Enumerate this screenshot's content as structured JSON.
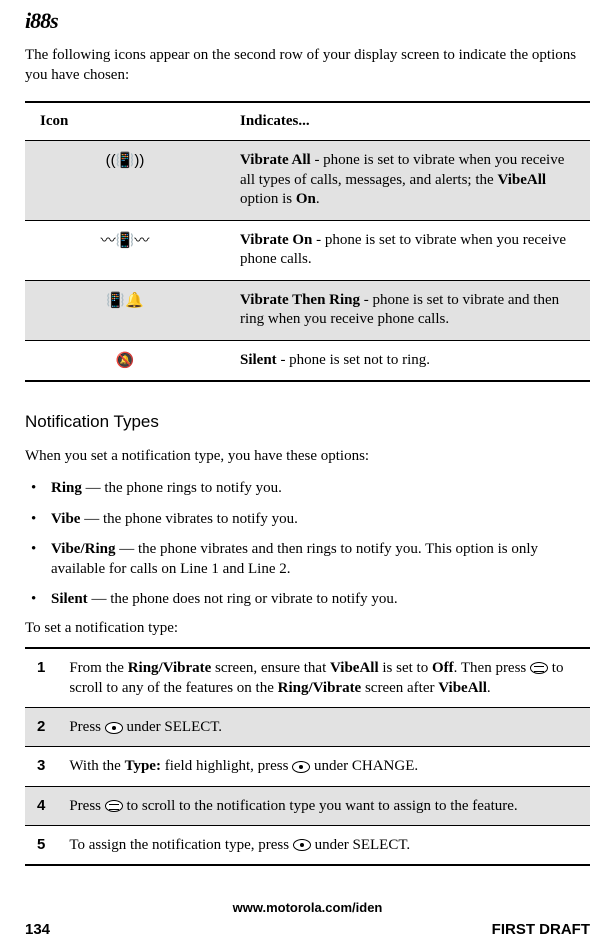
{
  "logo": "i88s",
  "intro": "The following icons appear on the second row of your display screen to indicate the options you have chosen:",
  "iconTable": {
    "headers": {
      "icon": "Icon",
      "indicates": "Indicates..."
    },
    "rows": [
      {
        "iconGlyph": "((📳))",
        "title": "Vibrate All",
        "desc": " - phone is set to vibrate when you receive all types of calls, messages, and alerts; the ",
        "opt": "VibeAll",
        "desc2": " option is ",
        "state": "On",
        "desc3": "."
      },
      {
        "iconGlyph": "〰📳〰",
        "title": "Vibrate On",
        "desc": " - phone is set to vibrate when you receive phone calls."
      },
      {
        "iconGlyph": "📳🔔",
        "title": "Vibrate Then Ring",
        "desc": " - phone is set to vibrate and then ring when you receive phone calls."
      },
      {
        "iconGlyph": "🔕",
        "title": "Silent",
        "desc": " - phone is set not to ring."
      }
    ]
  },
  "section": {
    "heading": "Notification Types",
    "intro": "When you set a notification type, you have these options:",
    "bullets": [
      {
        "term": "Ring",
        "desc": " — the phone rings to notify you."
      },
      {
        "term": "Vibe",
        "desc": " — the phone vibrates to notify you."
      },
      {
        "term": "Vibe/Ring",
        "desc": " — the phone vibrates and then rings to notify you. This option is only available for calls on Line 1 and Line 2."
      },
      {
        "term": "Silent",
        "desc": " — the phone does not ring or vibrate to notify you."
      }
    ],
    "stepsIntro": "To set a notification type:",
    "steps": [
      {
        "n": "1",
        "pre": "From the ",
        "b1": "Ring/Vibrate",
        "mid1": " screen, ensure that ",
        "b2": "VibeAll",
        "mid2": " is set to ",
        "b3": "Off",
        "mid3": ". Then press ",
        "icon": "arrows",
        "mid4": " to scroll to any of the features on the ",
        "b4": "Ring/Vibrate",
        "mid5": " screen after ",
        "b5": "VibeAll",
        "end": "."
      },
      {
        "n": "2",
        "pre": "Press ",
        "icon": "dot",
        "end": " under SELECT."
      },
      {
        "n": "3",
        "pre": "With the ",
        "b1": "Type:",
        "mid1": " field highlight, press ",
        "icon": "dot",
        "end": " under CHANGE."
      },
      {
        "n": "4",
        "pre": "Press ",
        "icon": "arrows",
        "end": " to scroll to the notification type you want to assign to the feature."
      },
      {
        "n": "5",
        "pre": "To assign the notification type, press ",
        "icon": "dot",
        "end": " under SELECT."
      }
    ]
  },
  "footer": {
    "url": "www.motorola.com/iden",
    "pageNum": "134",
    "draft": "FIRST DRAFT"
  }
}
